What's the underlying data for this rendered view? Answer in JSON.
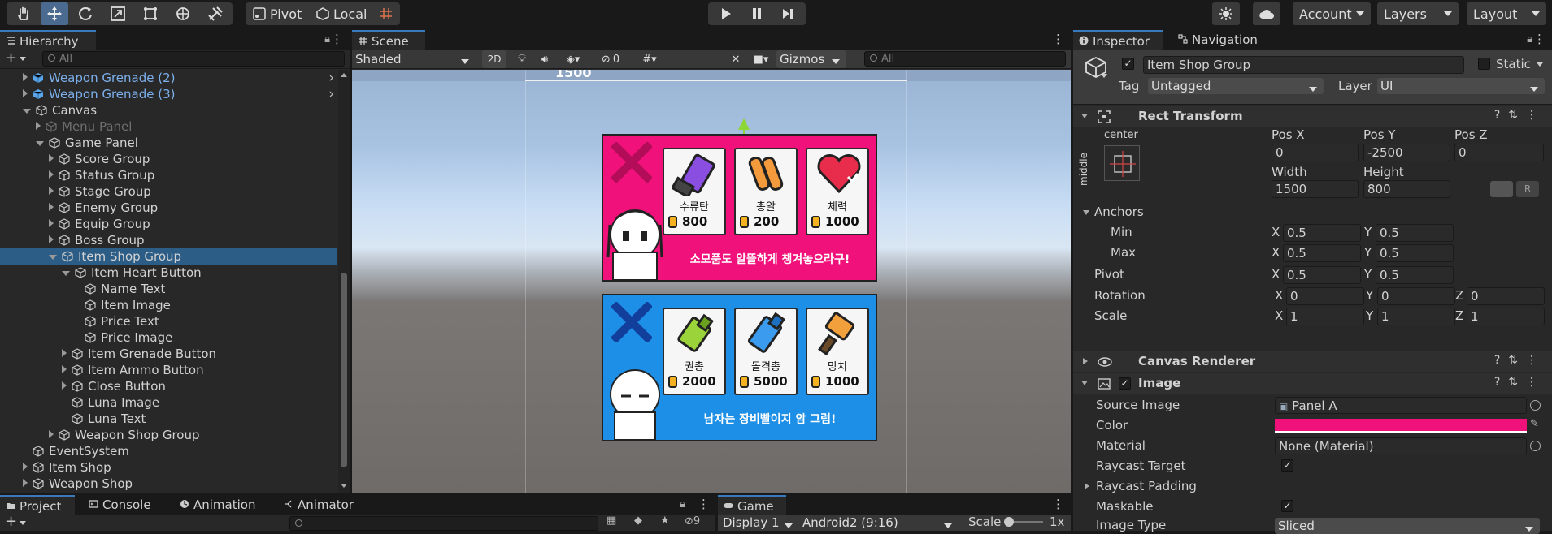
{
  "toolbar": {
    "pivot_label": "Pivot",
    "local_label": "Local",
    "account_label": "Account",
    "layers_label": "Layers",
    "layout_label": "Layout"
  },
  "hierarchy": {
    "tab_label": "Hierarchy",
    "search_placeholder": "All",
    "rows": [
      {
        "label": "Weapon Grenade (2)",
        "indent": 1,
        "arrow": "r",
        "style": "blue",
        "prefab": true
      },
      {
        "label": "Weapon Grenade (3)",
        "indent": 1,
        "arrow": "r",
        "style": "blue",
        "prefab": true
      },
      {
        "label": "Canvas",
        "indent": 1,
        "arrow": "d",
        "style": "normal"
      },
      {
        "label": "Menu Panel",
        "indent": 2,
        "arrow": "r",
        "style": "dim"
      },
      {
        "label": "Game Panel",
        "indent": 2,
        "arrow": "d",
        "style": "normal"
      },
      {
        "label": "Score Group",
        "indent": 3,
        "arrow": "r",
        "style": "normal"
      },
      {
        "label": "Status Group",
        "indent": 3,
        "arrow": "r",
        "style": "normal"
      },
      {
        "label": "Stage Group",
        "indent": 3,
        "arrow": "r",
        "style": "normal"
      },
      {
        "label": "Enemy Group",
        "indent": 3,
        "arrow": "r",
        "style": "normal"
      },
      {
        "label": "Equip Group",
        "indent": 3,
        "arrow": "r",
        "style": "normal"
      },
      {
        "label": "Boss Group",
        "indent": 3,
        "arrow": "r",
        "style": "normal"
      },
      {
        "label": "Item Shop Group",
        "indent": 3,
        "arrow": "d",
        "style": "selected"
      },
      {
        "label": "Item Heart Button",
        "indent": 4,
        "arrow": "d",
        "style": "normal"
      },
      {
        "label": "Name Text",
        "indent": 5,
        "arrow": "none",
        "style": "normal"
      },
      {
        "label": "Item Image",
        "indent": 5,
        "arrow": "none",
        "style": "normal"
      },
      {
        "label": "Price Text",
        "indent": 5,
        "arrow": "none",
        "style": "normal"
      },
      {
        "label": "Price Image",
        "indent": 5,
        "arrow": "none",
        "style": "normal"
      },
      {
        "label": "Item Grenade Button",
        "indent": 4,
        "arrow": "r",
        "style": "normal"
      },
      {
        "label": "Item Ammo Button",
        "indent": 4,
        "arrow": "r",
        "style": "normal"
      },
      {
        "label": "Close Button",
        "indent": 4,
        "arrow": "r",
        "style": "normal"
      },
      {
        "label": "Luna Image",
        "indent": 4,
        "arrow": "none",
        "style": "normal"
      },
      {
        "label": "Luna Text",
        "indent": 4,
        "arrow": "none",
        "style": "normal"
      },
      {
        "label": "Weapon Shop Group",
        "indent": 3,
        "arrow": "r",
        "style": "normal"
      },
      {
        "label": "EventSystem",
        "indent": 1,
        "arrow": "none",
        "style": "normal"
      },
      {
        "label": "Item Shop",
        "indent": 1,
        "arrow": "r",
        "style": "normal"
      },
      {
        "label": "Weapon Shop",
        "indent": 1,
        "arrow": "r",
        "style": "normal"
      }
    ]
  },
  "scene": {
    "tab_label": "Scene",
    "shading": "Shaded",
    "mode_2d": "2D",
    "hidden_count": "0",
    "gizmos_label": "Gizmos",
    "search_placeholder": "All",
    "top_text": "1500",
    "item_shop": {
      "caption": "소모품도 알뜰하게 챙겨놓으라구!",
      "color": "#f0127a",
      "items": [
        {
          "name": "수류탄",
          "price": "800"
        },
        {
          "name": "총알",
          "price": "200"
        },
        {
          "name": "체력",
          "price": "1000"
        }
      ]
    },
    "weapon_shop": {
      "caption": "남자는 장비빨이지 암 그럼!",
      "color": "#1d8fe6",
      "items": [
        {
          "name": "권총",
          "price": "2000"
        },
        {
          "name": "돌격총",
          "price": "5000"
        },
        {
          "name": "망치",
          "price": "1000"
        }
      ]
    }
  },
  "bottom_left": {
    "tabs": [
      "Project",
      "Console",
      "Animation",
      "Animator"
    ],
    "badge": "9"
  },
  "game": {
    "tab_label": "Game",
    "display": "Display 1",
    "resolution": "Android2 (9:16)",
    "scale_label": "Scale",
    "scale_value": "1x"
  },
  "inspector": {
    "tab_label": "Inspector",
    "nav_tab_label": "Navigation",
    "object_name": "Item Shop Group",
    "static_label": "Static",
    "tag_label": "Tag",
    "tag_value": "Untagged",
    "layer_label": "Layer",
    "layer_value": "UI",
    "rect_transform": {
      "title": "Rect Transform",
      "anchor_h": "center",
      "anchor_v": "middle",
      "posx_label": "Pos X",
      "posx": "0",
      "posy_label": "Pos Y",
      "posy": "-2500",
      "posz_label": "Pos Z",
      "posz": "0",
      "width_label": "Width",
      "width": "1500",
      "height_label": "Height",
      "height": "800",
      "r_label": "R",
      "anchors_label": "Anchors",
      "min_label": "Min",
      "min_x": "0.5",
      "min_y": "0.5",
      "max_label": "Max",
      "max_x": "0.5",
      "max_y": "0.5",
      "pivot_label": "Pivot",
      "pivot_x": "0.5",
      "pivot_y": "0.5",
      "rotation_label": "Rotation",
      "rot_x": "0",
      "rot_y": "0",
      "rot_z": "0",
      "scale_label": "Scale",
      "scale_x": "1",
      "scale_y": "1",
      "scale_z": "1",
      "x": "X",
      "y": "Y",
      "z": "Z"
    },
    "canvas_renderer": {
      "title": "Canvas Renderer"
    },
    "image": {
      "title": "Image",
      "source_label": "Source Image",
      "source_value": "Panel A",
      "color_label": "Color",
      "color_value": "#f0127a",
      "material_label": "Material",
      "material_value": "None (Material)",
      "raycast_label": "Raycast Target",
      "padding_label": "Raycast Padding",
      "maskable_label": "Maskable",
      "type_label": "Image Type",
      "type_value": "Sliced"
    }
  }
}
